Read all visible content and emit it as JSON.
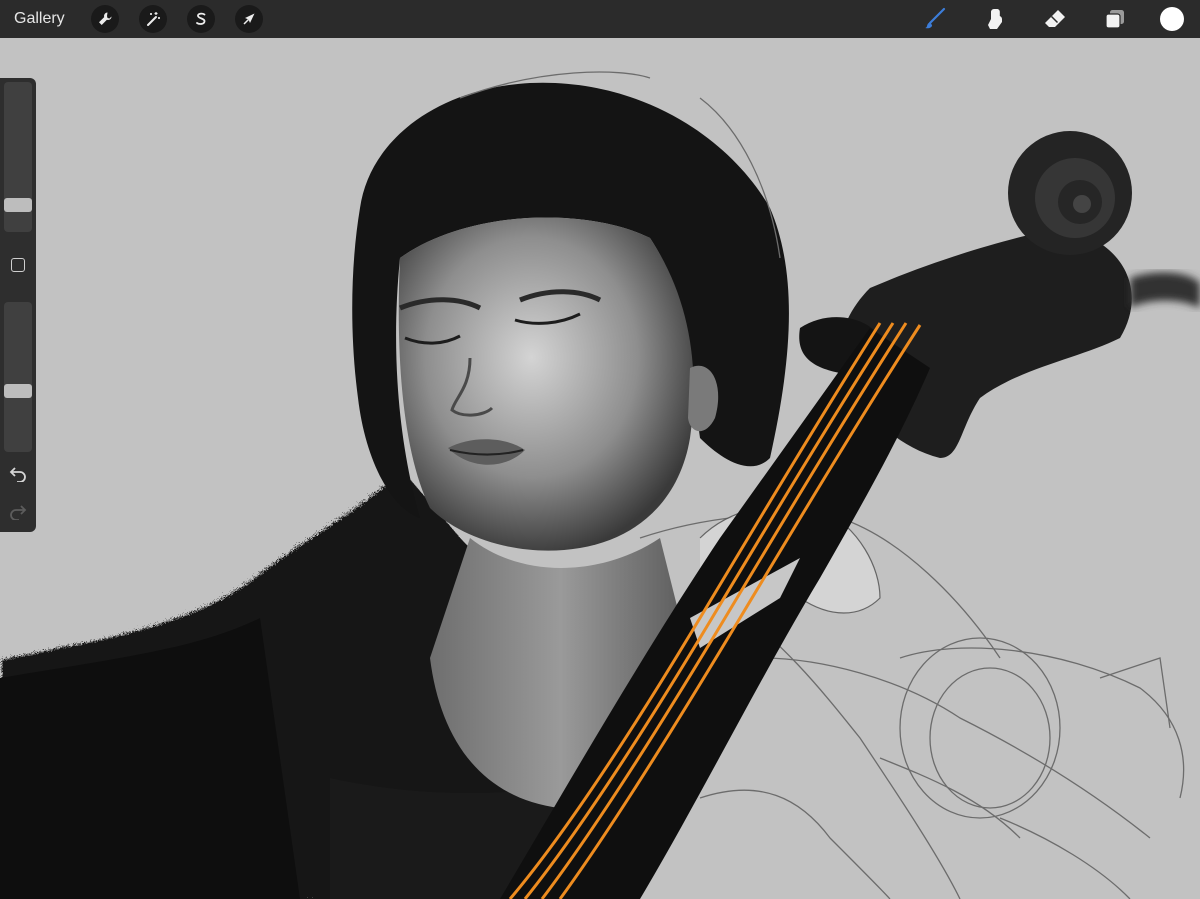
{
  "topbar": {
    "gallery_label": "Gallery",
    "left_tools": [
      "wrench-icon",
      "magic-wand-icon",
      "selection-s-icon",
      "transform-arrow-icon"
    ],
    "right_tools": [
      "brush-icon",
      "smudge-icon",
      "eraser-icon",
      "layers-icon"
    ],
    "active_tool": "brush-icon",
    "active_color": "#ffffff",
    "accent": "#3c7dd9"
  },
  "sidebar": {
    "brush_size": 0.15,
    "brush_opacity": 0.4
  }
}
